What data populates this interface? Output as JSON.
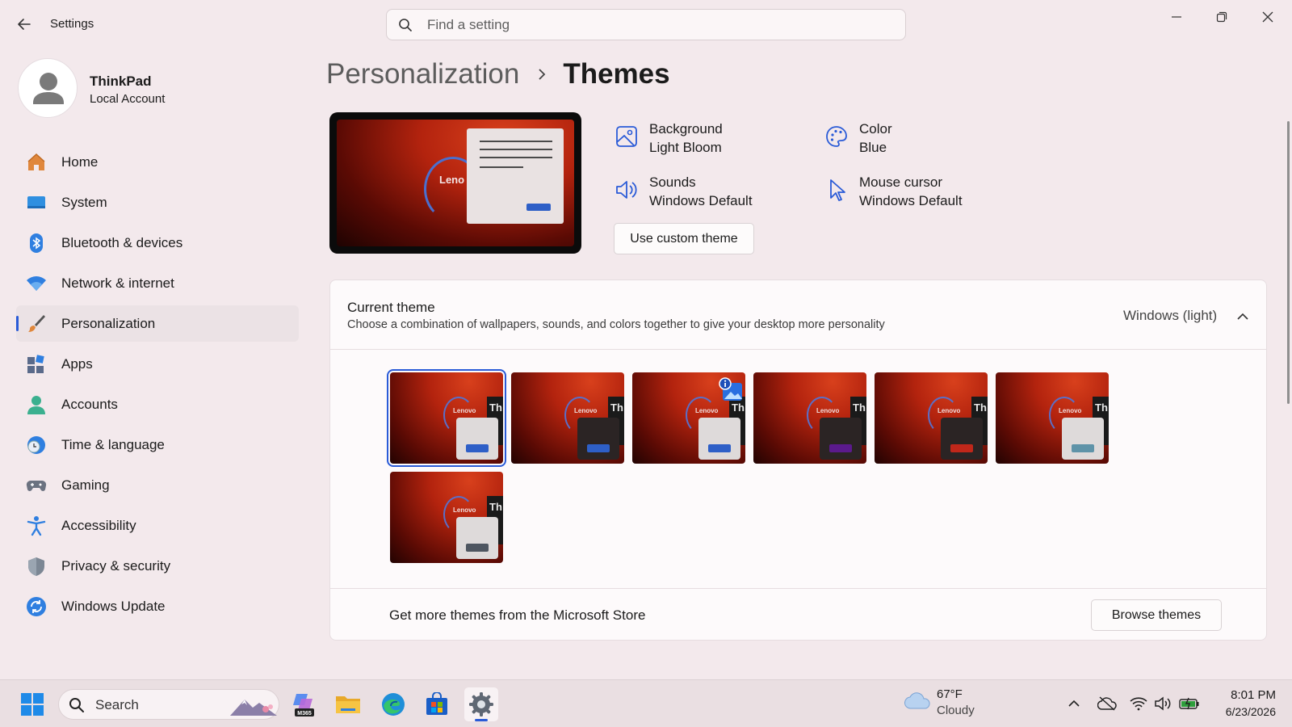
{
  "window": {
    "title": "Settings",
    "search_placeholder": "Find a setting"
  },
  "profile": {
    "name": "ThinkPad",
    "account_type": "Local Account"
  },
  "sidebar": {
    "items": [
      {
        "label": "Home",
        "icon": "home-icon"
      },
      {
        "label": "System",
        "icon": "system-icon"
      },
      {
        "label": "Bluetooth & devices",
        "icon": "bluetooth-icon"
      },
      {
        "label": "Network & internet",
        "icon": "wifi-icon"
      },
      {
        "label": "Personalization",
        "icon": "brush-icon",
        "active": true
      },
      {
        "label": "Apps",
        "icon": "apps-icon"
      },
      {
        "label": "Accounts",
        "icon": "accounts-icon"
      },
      {
        "label": "Time & language",
        "icon": "time-language-icon"
      },
      {
        "label": "Gaming",
        "icon": "gamepad-icon"
      },
      {
        "label": "Accessibility",
        "icon": "accessibility-icon"
      },
      {
        "label": "Privacy & security",
        "icon": "shield-icon"
      },
      {
        "label": "Windows Update",
        "icon": "update-icon"
      }
    ]
  },
  "breadcrumb": {
    "parent": "Personalization",
    "current": "Themes"
  },
  "preview": {
    "logo_text": "Leno"
  },
  "theme_props": {
    "background": {
      "label": "Background",
      "value": "Light Bloom"
    },
    "color": {
      "label": "Color",
      "value": "Blue"
    },
    "sounds": {
      "label": "Sounds",
      "value": "Windows Default"
    },
    "mouse_cursor": {
      "label": "Mouse cursor",
      "value": "Windows Default"
    },
    "custom_button": "Use custom theme"
  },
  "current_theme": {
    "title": "Current theme",
    "subtitle": "Choose a combination of wallpapers, sounds, and colors together to give your desktop more personality",
    "value": "Windows (light)",
    "thumbnails": [
      {
        "window": "#dedada",
        "button": "#2e5fc7",
        "selected": true
      },
      {
        "window": "#2b2424",
        "button": "#2e5fc7"
      },
      {
        "window": "#dedada",
        "button": "#2e5fc7",
        "spotlight": true
      },
      {
        "window": "#2b2424",
        "button": "#5b1a8c"
      },
      {
        "window": "#2b2424",
        "button": "#c0271a"
      },
      {
        "window": "#dedada",
        "button": "#5f93a8"
      },
      {
        "window": "#dedada",
        "button": "#4e5560"
      }
    ],
    "thumb_logo": "Lenovo",
    "thumb_dark_text": "Th",
    "store_text": "Get more themes from the Microsoft Store",
    "browse_button": "Browse themes"
  },
  "taskbar": {
    "search_label": "Search",
    "weather_temp": "67°F",
    "weather_desc": "Cloudy",
    "time": "8:01 PM",
    "date": "6/23/2026",
    "m365_label": "M365"
  },
  "colors": {
    "accent": "#2a5bd7",
    "background": "#f3e9ec"
  }
}
